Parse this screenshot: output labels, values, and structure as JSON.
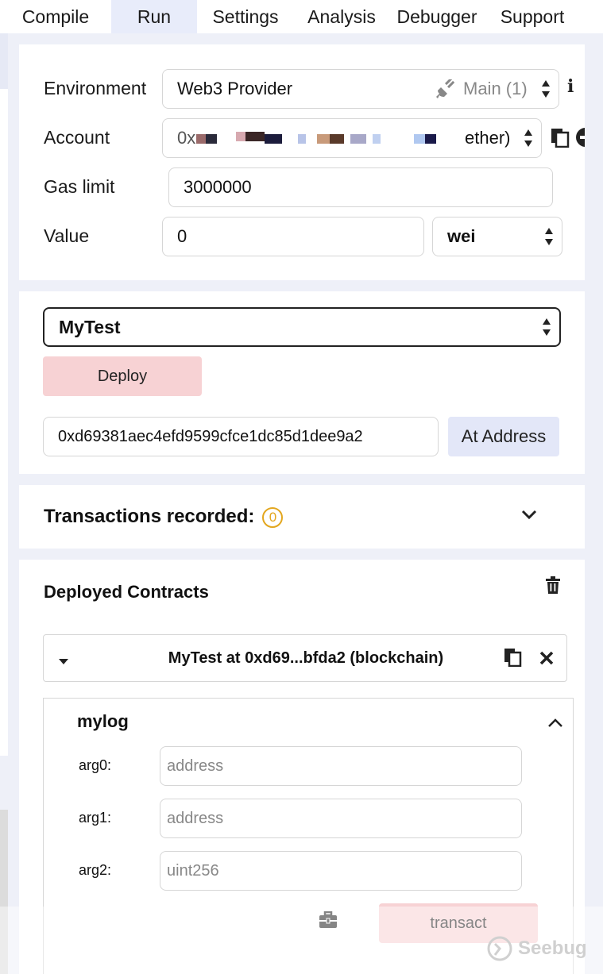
{
  "tabs": [
    {
      "label": "Compile",
      "active": false
    },
    {
      "label": "Run",
      "active": true
    },
    {
      "label": "Settings",
      "active": false
    },
    {
      "label": "Analysis",
      "active": false
    },
    {
      "label": "Debugger",
      "active": false
    },
    {
      "label": "Support",
      "active": false
    }
  ],
  "settings": {
    "environment_label": "Environment",
    "environment_value": "Web3 Provider",
    "network_value": "Main (1)",
    "account_label": "Account",
    "account_prefix": "0x",
    "account_suffix": "ether)",
    "gas_label": "Gas limit",
    "gas_value": "3000000",
    "value_label": "Value",
    "value_value": "0",
    "unit_value": "wei"
  },
  "deploy": {
    "contract_selected": "MyTest",
    "deploy_label": "Deploy",
    "address_value": "0xd69381aec4efd9599cfce1dc85d1dee9a2",
    "at_address_label": "At Address"
  },
  "transactions": {
    "label": "Transactions recorded:",
    "count": "0"
  },
  "deployed": {
    "title": "Deployed Contracts",
    "instance_label": "MyTest at 0xd69...bfda2 (blockchain)",
    "function_name": "mylog",
    "args": [
      {
        "label": "arg0:",
        "placeholder": "address"
      },
      {
        "label": "arg1:",
        "placeholder": "address"
      },
      {
        "label": "arg2:",
        "placeholder": "uint256"
      }
    ],
    "transact_label": "transact"
  },
  "watermark": "Seebug",
  "colors": {
    "active_tab": "#e8ecfa",
    "deploy_button": "#f7d2d4",
    "at_address_button": "#e3e7f8",
    "badge": "#e3a71f"
  }
}
